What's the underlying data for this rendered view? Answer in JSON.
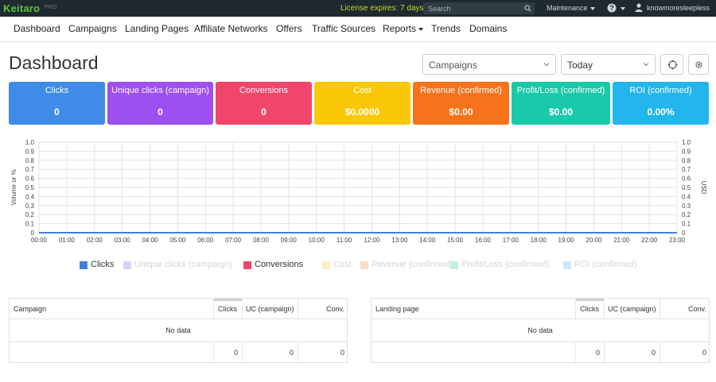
{
  "topbar": {
    "logo": "Keitaro",
    "logo_badge": "PRO",
    "license": "License expires: 7 days",
    "search_placeholder": "Search",
    "maintenance": "Maintenance",
    "username": "knowmoresleepless"
  },
  "nav": {
    "items": [
      "Dashboard",
      "Campaigns",
      "Landing Pages",
      "Affiliate Networks",
      "Offers",
      "Traffic Sources",
      "Reports",
      "Trends",
      "Domains"
    ]
  },
  "page": {
    "title": "Dashboard",
    "group_select": "Campaigns",
    "period_select": "Today"
  },
  "metrics": [
    {
      "label": "Clicks",
      "value": "0",
      "color": "#3f8be8"
    },
    {
      "label": "Unique clicks (campaign)",
      "value": "0",
      "color": "#9d4ff0"
    },
    {
      "label": "Conversions",
      "value": "0",
      "color": "#f0466c"
    },
    {
      "label": "Cost",
      "value": "$0.0000",
      "color": "#fbc808"
    },
    {
      "label": "Revenue (confirmed)",
      "value": "$0.00",
      "color": "#f6731b"
    },
    {
      "label": "Profit/Loss (confirmed)",
      "value": "$0.00",
      "color": "#19c9a9"
    },
    {
      "label": "ROI (confirmed)",
      "value": "0.00%",
      "color": "#22b6ec"
    }
  ],
  "chart_data": {
    "type": "line",
    "x": [
      "00:00",
      "01:00",
      "02:00",
      "03:00",
      "04:00",
      "05:00",
      "06:00",
      "07:00",
      "08:00",
      "09:00",
      "10:00",
      "11:00",
      "12:00",
      "13:00",
      "14:00",
      "15:00",
      "16:00",
      "17:00",
      "18:00",
      "19:00",
      "20:00",
      "21:00",
      "22:00",
      "23:00"
    ],
    "ylabel": "Volume or %",
    "y2label": "USD",
    "ylim": [
      0,
      1
    ],
    "y2lim": [
      0,
      1
    ],
    "yticks": [
      "0",
      "0.1",
      "0.2",
      "0.3",
      "0.4",
      "0.5",
      "0.6",
      "0.7",
      "0.8",
      "0.9",
      "1.0"
    ],
    "grid": true,
    "legend_position": "bottom",
    "series": [
      {
        "name": "Clicks",
        "values": [
          0,
          0,
          0,
          0,
          0,
          0,
          0,
          0,
          0,
          0,
          0,
          0,
          0,
          0,
          0,
          0,
          0,
          0,
          0,
          0,
          0,
          0,
          0,
          0
        ],
        "color": "#3f7fe0",
        "visible": true
      },
      {
        "name": "Unique clicks (campaign)",
        "values": [],
        "color": "#d9d2f7",
        "visible": false
      },
      {
        "name": "Conversions",
        "values": [
          0,
          0,
          0,
          0,
          0,
          0,
          0,
          0,
          0,
          0,
          0,
          0,
          0,
          0,
          0,
          0,
          0,
          0,
          0,
          0,
          0,
          0,
          0,
          0
        ],
        "color": "#f0466c",
        "visible": true
      },
      {
        "name": "Cost",
        "values": [],
        "color": "#fdeec0",
        "visible": false
      },
      {
        "name": "Revenue (confirmed)",
        "values": [],
        "color": "#fddcc6",
        "visible": false
      },
      {
        "name": "Profit/Loss (confirmed)",
        "values": [],
        "color": "#c5efe6",
        "visible": false
      },
      {
        "name": "ROI (confirmed)",
        "values": [],
        "color": "#c8ebfa",
        "visible": false
      }
    ]
  },
  "tables": [
    {
      "first_col": "Campaign",
      "columns": [
        "Clicks",
        "UC (campaign)",
        "Conv."
      ],
      "empty_text": "No data",
      "totals": [
        "0",
        "0",
        "0"
      ]
    },
    {
      "first_col": "Landing page",
      "columns": [
        "Clicks",
        "UC (campaign)",
        "Conv."
      ],
      "empty_text": "No data",
      "totals": [
        "0",
        "0",
        "0"
      ]
    }
  ]
}
